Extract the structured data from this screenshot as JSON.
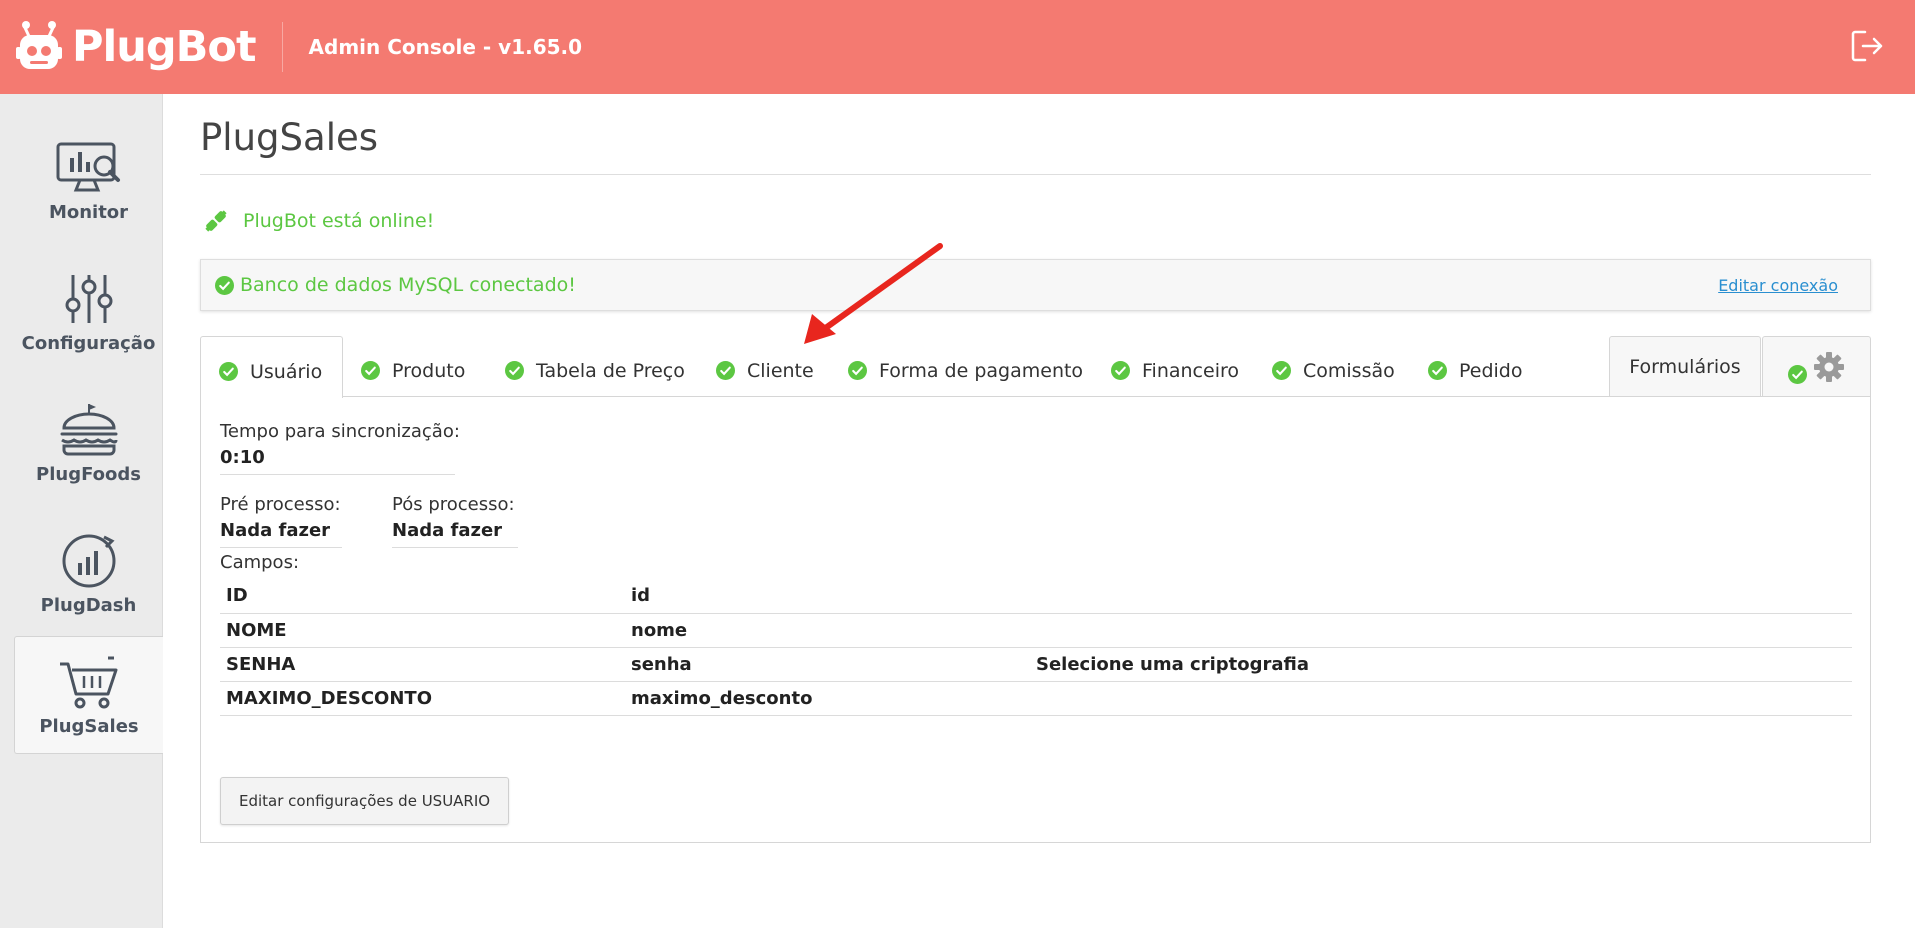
{
  "header": {
    "app_name": "PlugBot",
    "console_title": "Admin Console - v1.65.0"
  },
  "sidebar": {
    "items": [
      {
        "label": "Monitor",
        "icon": "monitor-chart-icon"
      },
      {
        "label": "Configuração",
        "icon": "sliders-icon"
      },
      {
        "label": "PlugFoods",
        "icon": "burger-icon"
      },
      {
        "label": "PlugDash",
        "icon": "dashboard-chart-icon"
      },
      {
        "label": "PlugSales",
        "icon": "shopping-cart-icon",
        "active": true
      }
    ]
  },
  "main": {
    "page_title": "PlugSales",
    "online_status": "PlugBot está online!",
    "db_status": "Banco de dados MySQL conectado!",
    "edit_connection": "Editar conexão",
    "tabs": [
      {
        "label": "Usuário",
        "active": true
      },
      {
        "label": "Produto"
      },
      {
        "label": "Tabela de Preço"
      },
      {
        "label": "Cliente"
      },
      {
        "label": "Forma de pagamento"
      },
      {
        "label": "Financeiro"
      },
      {
        "label": "Comissão"
      },
      {
        "label": "Pedido"
      }
    ],
    "forms_tab": "Formulários",
    "panel": {
      "sync_label": "Tempo para sincronização:",
      "sync_value": "0:10",
      "pre_label": "Pré processo:",
      "pre_value": "Nada fazer",
      "pos_label": "Pós processo:",
      "pos_value": "Nada fazer",
      "campos_label": "Campos:",
      "campos": [
        {
          "name": "ID",
          "column": "id",
          "extra": ""
        },
        {
          "name": "NOME",
          "column": "nome",
          "extra": ""
        },
        {
          "name": "SENHA",
          "column": "senha",
          "extra": "Selecione uma criptografia"
        },
        {
          "name": "MAXIMO_DESCONTO",
          "column": "maximo_desconto",
          "extra": ""
        }
      ],
      "edit_button": "Editar configurações de USUARIO"
    }
  },
  "colors": {
    "header_bg": "#f47a71",
    "success_green": "#5cc742",
    "link_blue": "#2a8fd0",
    "arrow_red": "#e8261e"
  }
}
